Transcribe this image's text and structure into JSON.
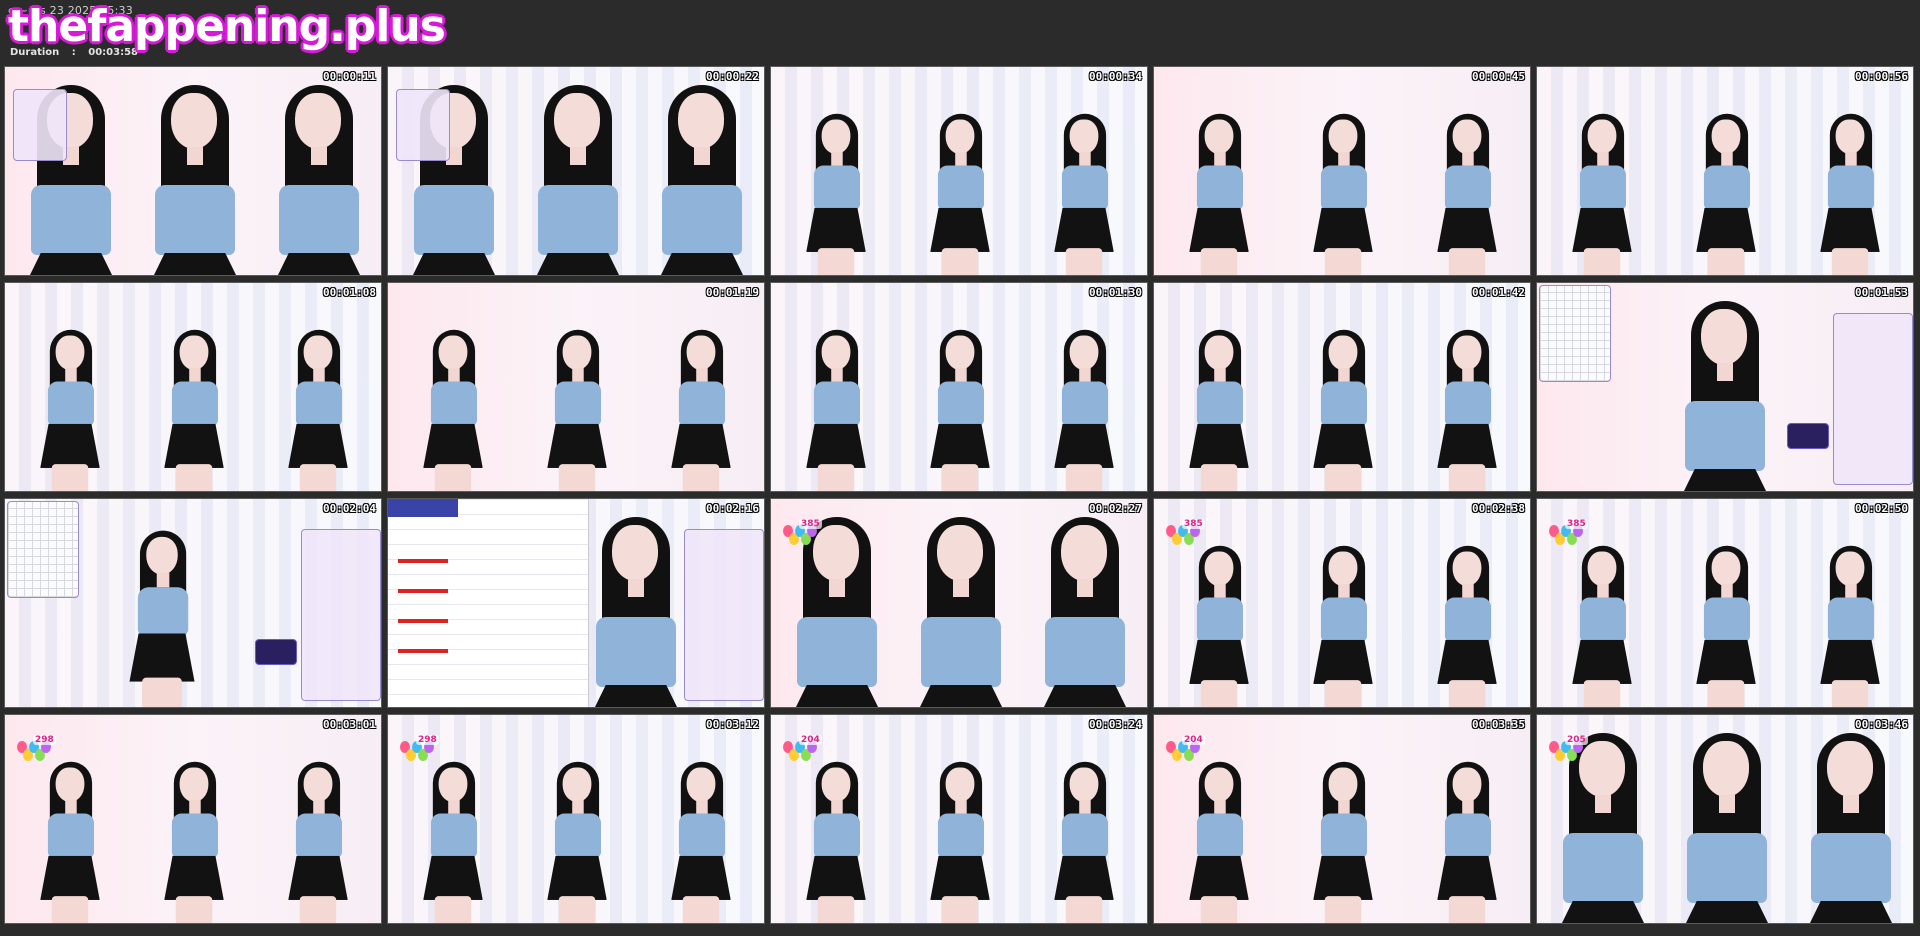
{
  "header": {
    "partial_title": "e          ~ .ts  23  2025 05:33",
    "duration_label": "Duration",
    "duration_sep": ":",
    "duration_value": "00:03:58"
  },
  "watermark": {
    "text": "thefappening.plus",
    "fill_color": "#ffffff",
    "outline_color": "#d81ad8"
  },
  "thumbnails": [
    {
      "time": "00:00:11",
      "scene": "three-up-closeup",
      "overlay": "stream-card-left"
    },
    {
      "time": "00:00:22",
      "scene": "three-up-closeup",
      "overlay": "stream-card-left"
    },
    {
      "time": "00:00:34",
      "scene": "three-up-seated",
      "overlay": "none"
    },
    {
      "time": "00:00:45",
      "scene": "three-up-seated",
      "overlay": "none"
    },
    {
      "time": "00:00:56",
      "scene": "three-up-seated",
      "overlay": "none"
    },
    {
      "time": "00:01:08",
      "scene": "three-up-seated",
      "overlay": "none"
    },
    {
      "time": "00:01:19",
      "scene": "three-up-seated",
      "overlay": "none"
    },
    {
      "time": "00:01:30",
      "scene": "three-up-standing",
      "overlay": "none"
    },
    {
      "time": "00:01:42",
      "scene": "three-up-seated",
      "overlay": "none"
    },
    {
      "time": "00:01:53",
      "scene": "single-closeup",
      "overlay": "board-panels"
    },
    {
      "time": "00:02:04",
      "scene": "single-standing",
      "overlay": "board-panels"
    },
    {
      "time": "00:02:16",
      "scene": "notebook-closeup",
      "overlay": "notebook"
    },
    {
      "time": "00:02:27",
      "scene": "three-up-torso",
      "overlay": "balloons"
    },
    {
      "time": "00:02:38",
      "scene": "three-up-standing",
      "overlay": "balloons"
    },
    {
      "time": "00:02:50",
      "scene": "three-up-standing",
      "overlay": "balloons"
    },
    {
      "time": "00:03:01",
      "scene": "three-up-standing",
      "overlay": "balloons"
    },
    {
      "time": "00:03:12",
      "scene": "three-up-standing",
      "overlay": "balloons"
    },
    {
      "time": "00:03:24",
      "scene": "three-up-standing",
      "overlay": "balloons"
    },
    {
      "time": "00:03:35",
      "scene": "three-up-standing",
      "overlay": "balloons"
    },
    {
      "time": "00:03:46",
      "scene": "three-up-closeup",
      "overlay": "balloons"
    }
  ],
  "overlay_counters": {
    "t12": "385",
    "t13": "385",
    "t14": "385",
    "t15": "298",
    "t16": "298",
    "t17": "204",
    "t18": "204",
    "t19": "205"
  },
  "colors": {
    "background": "#2b2b2b",
    "top_garment": "#8fb3d9",
    "skirt": "#121212",
    "hair": "#111111",
    "counter_text": "#e0208a"
  }
}
